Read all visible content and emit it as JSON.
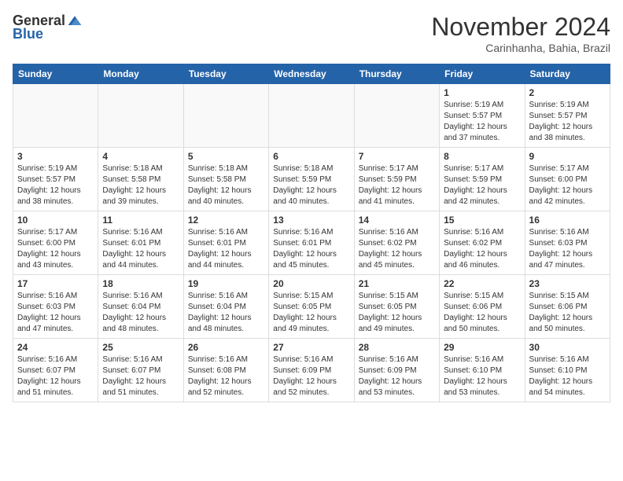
{
  "header": {
    "logo_general": "General",
    "logo_blue": "Blue",
    "month_title": "November 2024",
    "location": "Carinhanha, Bahia, Brazil"
  },
  "calendar": {
    "days_of_week": [
      "Sunday",
      "Monday",
      "Tuesday",
      "Wednesday",
      "Thursday",
      "Friday",
      "Saturday"
    ],
    "weeks": [
      [
        {
          "day": "",
          "info": ""
        },
        {
          "day": "",
          "info": ""
        },
        {
          "day": "",
          "info": ""
        },
        {
          "day": "",
          "info": ""
        },
        {
          "day": "",
          "info": ""
        },
        {
          "day": "1",
          "info": "Sunrise: 5:19 AM\nSunset: 5:57 PM\nDaylight: 12 hours\nand 37 minutes."
        },
        {
          "day": "2",
          "info": "Sunrise: 5:19 AM\nSunset: 5:57 PM\nDaylight: 12 hours\nand 38 minutes."
        }
      ],
      [
        {
          "day": "3",
          "info": "Sunrise: 5:19 AM\nSunset: 5:57 PM\nDaylight: 12 hours\nand 38 minutes."
        },
        {
          "day": "4",
          "info": "Sunrise: 5:18 AM\nSunset: 5:58 PM\nDaylight: 12 hours\nand 39 minutes."
        },
        {
          "day": "5",
          "info": "Sunrise: 5:18 AM\nSunset: 5:58 PM\nDaylight: 12 hours\nand 40 minutes."
        },
        {
          "day": "6",
          "info": "Sunrise: 5:18 AM\nSunset: 5:59 PM\nDaylight: 12 hours\nand 40 minutes."
        },
        {
          "day": "7",
          "info": "Sunrise: 5:17 AM\nSunset: 5:59 PM\nDaylight: 12 hours\nand 41 minutes."
        },
        {
          "day": "8",
          "info": "Sunrise: 5:17 AM\nSunset: 5:59 PM\nDaylight: 12 hours\nand 42 minutes."
        },
        {
          "day": "9",
          "info": "Sunrise: 5:17 AM\nSunset: 6:00 PM\nDaylight: 12 hours\nand 42 minutes."
        }
      ],
      [
        {
          "day": "10",
          "info": "Sunrise: 5:17 AM\nSunset: 6:00 PM\nDaylight: 12 hours\nand 43 minutes."
        },
        {
          "day": "11",
          "info": "Sunrise: 5:16 AM\nSunset: 6:01 PM\nDaylight: 12 hours\nand 44 minutes."
        },
        {
          "day": "12",
          "info": "Sunrise: 5:16 AM\nSunset: 6:01 PM\nDaylight: 12 hours\nand 44 minutes."
        },
        {
          "day": "13",
          "info": "Sunrise: 5:16 AM\nSunset: 6:01 PM\nDaylight: 12 hours\nand 45 minutes."
        },
        {
          "day": "14",
          "info": "Sunrise: 5:16 AM\nSunset: 6:02 PM\nDaylight: 12 hours\nand 45 minutes."
        },
        {
          "day": "15",
          "info": "Sunrise: 5:16 AM\nSunset: 6:02 PM\nDaylight: 12 hours\nand 46 minutes."
        },
        {
          "day": "16",
          "info": "Sunrise: 5:16 AM\nSunset: 6:03 PM\nDaylight: 12 hours\nand 47 minutes."
        }
      ],
      [
        {
          "day": "17",
          "info": "Sunrise: 5:16 AM\nSunset: 6:03 PM\nDaylight: 12 hours\nand 47 minutes."
        },
        {
          "day": "18",
          "info": "Sunrise: 5:16 AM\nSunset: 6:04 PM\nDaylight: 12 hours\nand 48 minutes."
        },
        {
          "day": "19",
          "info": "Sunrise: 5:16 AM\nSunset: 6:04 PM\nDaylight: 12 hours\nand 48 minutes."
        },
        {
          "day": "20",
          "info": "Sunrise: 5:15 AM\nSunset: 6:05 PM\nDaylight: 12 hours\nand 49 minutes."
        },
        {
          "day": "21",
          "info": "Sunrise: 5:15 AM\nSunset: 6:05 PM\nDaylight: 12 hours\nand 49 minutes."
        },
        {
          "day": "22",
          "info": "Sunrise: 5:15 AM\nSunset: 6:06 PM\nDaylight: 12 hours\nand 50 minutes."
        },
        {
          "day": "23",
          "info": "Sunrise: 5:15 AM\nSunset: 6:06 PM\nDaylight: 12 hours\nand 50 minutes."
        }
      ],
      [
        {
          "day": "24",
          "info": "Sunrise: 5:16 AM\nSunset: 6:07 PM\nDaylight: 12 hours\nand 51 minutes."
        },
        {
          "day": "25",
          "info": "Sunrise: 5:16 AM\nSunset: 6:07 PM\nDaylight: 12 hours\nand 51 minutes."
        },
        {
          "day": "26",
          "info": "Sunrise: 5:16 AM\nSunset: 6:08 PM\nDaylight: 12 hours\nand 52 minutes."
        },
        {
          "day": "27",
          "info": "Sunrise: 5:16 AM\nSunset: 6:09 PM\nDaylight: 12 hours\nand 52 minutes."
        },
        {
          "day": "28",
          "info": "Sunrise: 5:16 AM\nSunset: 6:09 PM\nDaylight: 12 hours\nand 53 minutes."
        },
        {
          "day": "29",
          "info": "Sunrise: 5:16 AM\nSunset: 6:10 PM\nDaylight: 12 hours\nand 53 minutes."
        },
        {
          "day": "30",
          "info": "Sunrise: 5:16 AM\nSunset: 6:10 PM\nDaylight: 12 hours\nand 54 minutes."
        }
      ]
    ]
  }
}
